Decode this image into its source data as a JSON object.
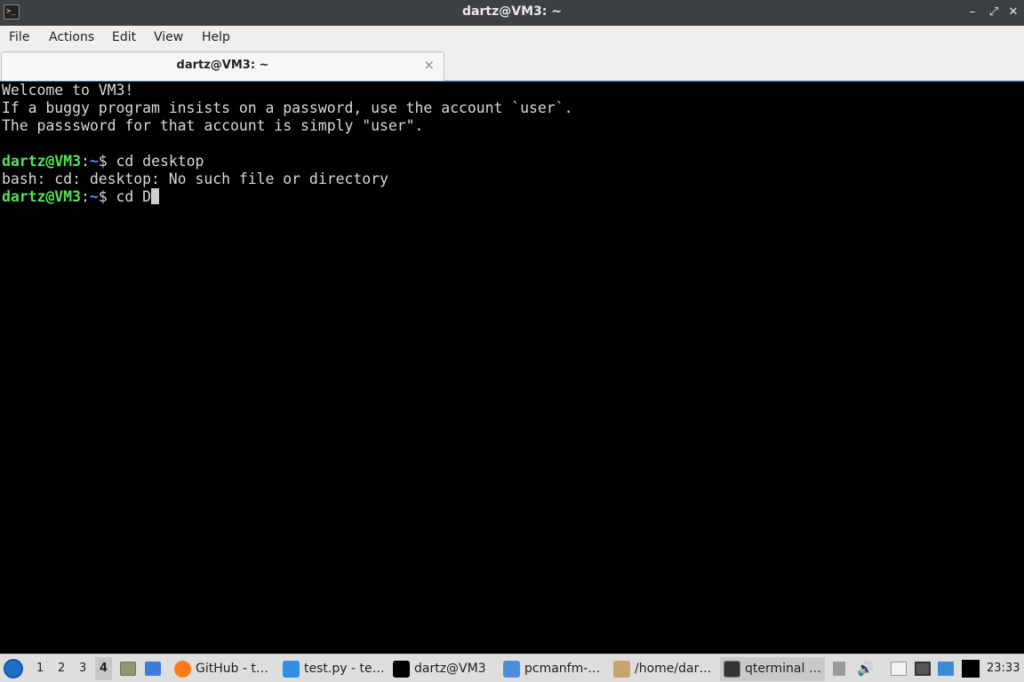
{
  "window": {
    "title": "dartz@VM3: ~",
    "minimize": "–",
    "maximize": "⤢",
    "close": "✕"
  },
  "menu": [
    "File",
    "Actions",
    "Edit",
    "View",
    "Help"
  ],
  "tab": {
    "label": "dartz@VM3: ~",
    "close": "×"
  },
  "terminal": {
    "lines": [
      "Welcome to VM3!",
      "If a buggy program insists on a password, use the account `user`.",
      "The passsword for that account is simply \"user\".",
      ""
    ],
    "prompt_user": "dartz@VM3",
    "prompt_sep": ":",
    "prompt_path": "~",
    "prompt_symbol": "$ ",
    "command1": "cd desktop",
    "error": "bash: cd: desktop: No such file or directory",
    "command2": "cd D"
  },
  "taskbar": {
    "desktops": [
      "1",
      "2",
      "3",
      "4"
    ],
    "active_desktop": "4",
    "tasks": [
      {
        "label": "GitHub - t…",
        "icon": "firefox-icon"
      },
      {
        "label": "test.py - te…",
        "icon": "vscode-icon"
      },
      {
        "label": "dartz@VM3",
        "icon": "terminal-icon"
      },
      {
        "label": "pcmanfm-…",
        "icon": "folder-icon"
      },
      {
        "label": "/home/dar…",
        "icon": "archive-icon"
      },
      {
        "label": "qterminal …",
        "icon": "terminal-icon"
      }
    ],
    "clock": "23:33"
  },
  "colors": {
    "titlebar": "#3c3f44",
    "prompt_user": "#55e055",
    "prompt_path": "#5c8cff",
    "terminal_bg": "#000000"
  }
}
